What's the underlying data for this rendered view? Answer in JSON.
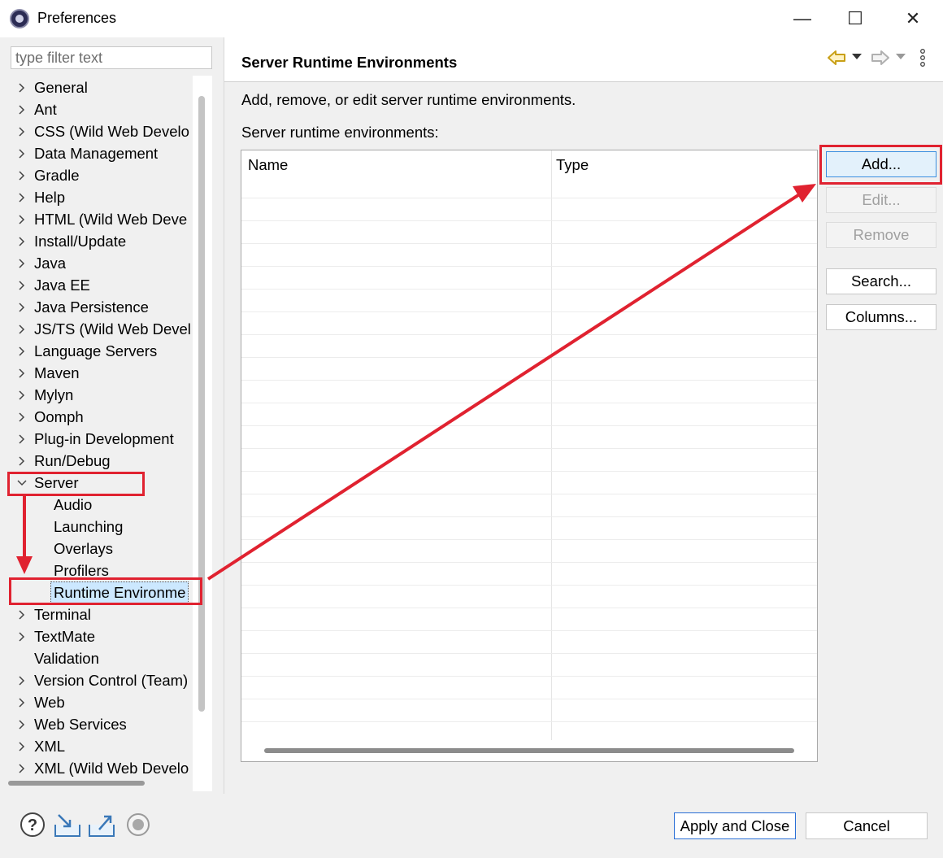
{
  "window": {
    "title": "Preferences",
    "minimize_glyph": "—",
    "maximize_glyph": "☐",
    "close_glyph": "✕"
  },
  "filter": {
    "placeholder": "type filter text"
  },
  "tree": {
    "items": [
      {
        "label": "General",
        "expander": "closed"
      },
      {
        "label": "Ant",
        "expander": "closed"
      },
      {
        "label": "CSS (Wild Web Develo",
        "expander": "closed"
      },
      {
        "label": "Data Management",
        "expander": "closed"
      },
      {
        "label": "Gradle",
        "expander": "closed"
      },
      {
        "label": "Help",
        "expander": "closed"
      },
      {
        "label": "HTML (Wild Web Deve",
        "expander": "closed"
      },
      {
        "label": "Install/Update",
        "expander": "closed"
      },
      {
        "label": "Java",
        "expander": "closed"
      },
      {
        "label": "Java EE",
        "expander": "closed"
      },
      {
        "label": "Java Persistence",
        "expander": "closed"
      },
      {
        "label": "JS/TS (Wild Web Devel",
        "expander": "closed"
      },
      {
        "label": "Language Servers",
        "expander": "closed"
      },
      {
        "label": "Maven",
        "expander": "closed"
      },
      {
        "label": "Mylyn",
        "expander": "closed"
      },
      {
        "label": "Oomph",
        "expander": "closed"
      },
      {
        "label": "Plug-in Development",
        "expander": "closed"
      },
      {
        "label": "Run/Debug",
        "expander": "closed"
      },
      {
        "label": "Server",
        "expander": "open"
      },
      {
        "label": "Audio",
        "expander": "none",
        "child": true
      },
      {
        "label": "Launching",
        "expander": "none",
        "child": true
      },
      {
        "label": "Overlays",
        "expander": "none",
        "child": true
      },
      {
        "label": "Profilers",
        "expander": "none",
        "child": true
      },
      {
        "label": "Runtime Environme",
        "expander": "none",
        "child": true,
        "selected": true
      },
      {
        "label": "Terminal",
        "expander": "closed"
      },
      {
        "label": "TextMate",
        "expander": "closed"
      },
      {
        "label": "Validation",
        "expander": "none"
      },
      {
        "label": "Version Control (Team)",
        "expander": "closed"
      },
      {
        "label": "Web",
        "expander": "closed"
      },
      {
        "label": "Web Services",
        "expander": "closed"
      },
      {
        "label": "XML",
        "expander": "closed"
      },
      {
        "label": "XML (Wild Web Develo",
        "expander": "closed"
      }
    ]
  },
  "page": {
    "title": "Server Runtime Environments",
    "description": "Add, remove, or edit server runtime environments.",
    "list_label": "Server runtime environments:"
  },
  "table": {
    "columns": [
      "Name",
      "Type"
    ],
    "rows": []
  },
  "buttons": {
    "add": "Add...",
    "edit": "Edit...",
    "remove": "Remove",
    "search": "Search...",
    "columns": "Columns...",
    "apply_close": "Apply and Close",
    "cancel": "Cancel"
  },
  "colors": {
    "annotation_red": "#e02230",
    "selection": "#cce8ff",
    "accent_blue": "#2a6fd6"
  }
}
